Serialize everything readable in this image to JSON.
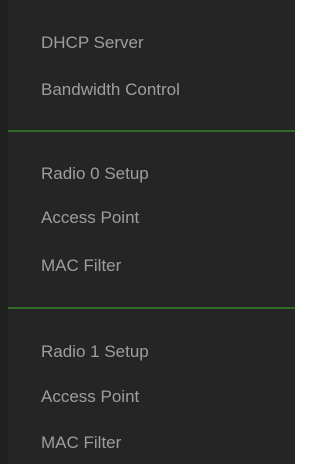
{
  "menu": {
    "group1": [
      {
        "label": "DHCP Server"
      },
      {
        "label": "Bandwidth Control"
      }
    ],
    "group2": [
      {
        "label": "Radio 0 Setup"
      },
      {
        "label": "Access Point"
      },
      {
        "label": "MAC Filter"
      }
    ],
    "group3": [
      {
        "label": "Radio 1 Setup"
      },
      {
        "label": "Access Point"
      },
      {
        "label": "MAC Filter"
      }
    ]
  },
  "colors": {
    "panel_background": "#252525",
    "text": "#9e9e9e",
    "divider": "#2f6b22",
    "page_background": "#ffffff"
  }
}
